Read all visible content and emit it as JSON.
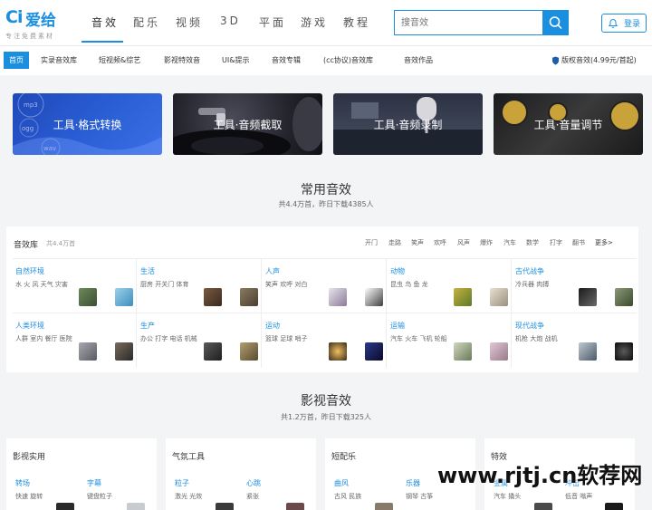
{
  "header": {
    "logo_mark": "Ci",
    "logo_name": "爱给",
    "logo_sub": "专注免费素材",
    "nav": [
      "音效",
      "配乐",
      "视频",
      "3D",
      "平面",
      "游戏",
      "教程"
    ],
    "search_placeholder": "搜音效",
    "login_label": "登录"
  },
  "subnav": {
    "home": "首页",
    "items": [
      "实录音效库",
      "短视频&综艺",
      "影视特效音",
      "UI&提示",
      "音效专辑",
      "(cc协议)音效库",
      "音效作品"
    ],
    "copyright": "版权音效(4.99元/首起)"
  },
  "banners": [
    "工具·格式转换",
    "工具·音频截取",
    "工具·音频录制",
    "工具·音量调节"
  ],
  "banner1_deco": [
    "mp3",
    "ogg",
    "wav"
  ],
  "common": {
    "title": "常用音效",
    "subtitle": "共4.4万首，昨日下载4385人"
  },
  "library": {
    "title": "音效库",
    "count": "共4.4万首",
    "tags": [
      "开门",
      "走路",
      "笑声",
      "欢呼",
      "风声",
      "爆炸",
      "汽车",
      "数学",
      "打字",
      "翻书"
    ],
    "more": "更多>",
    "cells": [
      {
        "title": "自然环境",
        "desc": "水 火 风 天气 灾害"
      },
      {
        "title": "生活",
        "desc": "厨房 开关门 体育"
      },
      {
        "title": "人声",
        "desc": "笑声 欢呼 对白"
      },
      {
        "title": "动物",
        "desc": "昆虫 鸟 鱼 龙"
      },
      {
        "title": "古代战争",
        "desc": "冷兵器 肉搏"
      },
      {
        "title": "人类环境",
        "desc": "人群 室内 餐厅 医院"
      },
      {
        "title": "生产",
        "desc": "办公 打字 电话 机械"
      },
      {
        "title": "运动",
        "desc": "篮球 足球 哨子"
      },
      {
        "title": "运输",
        "desc": "汽车 火车 飞机 轮船"
      },
      {
        "title": "现代战争",
        "desc": "机枪 大炮 战机"
      }
    ]
  },
  "film": {
    "title": "影视音效",
    "subtitle": "共1.2万首，昨日下载325人"
  },
  "cards": [
    {
      "title": "影视实用",
      "subs": [
        {
          "name": "转场",
          "desc": "快速 旋转"
        },
        {
          "name": "字幕",
          "desc": "键盘粒子"
        }
      ]
    },
    {
      "title": "气氛工具",
      "subs": [
        {
          "name": "粒子",
          "desc": "激光 光效"
        },
        {
          "name": "心跳",
          "desc": "紧张"
        }
      ]
    },
    {
      "title": "短配乐",
      "subs": [
        {
          "name": "曲风",
          "desc": "古风 民族"
        },
        {
          "name": "乐器",
          "desc": "钢琴 古筝"
        }
      ]
    },
    {
      "title": "特效",
      "subs": [
        {
          "name": "金属",
          "desc": "汽车 撬头"
        },
        {
          "name": "冲击",
          "desc": "低音 嗡声"
        }
      ]
    }
  ],
  "watermark": "www.rjtj.cn软荐网",
  "colors": {
    "accent": "#1a8fe0"
  }
}
